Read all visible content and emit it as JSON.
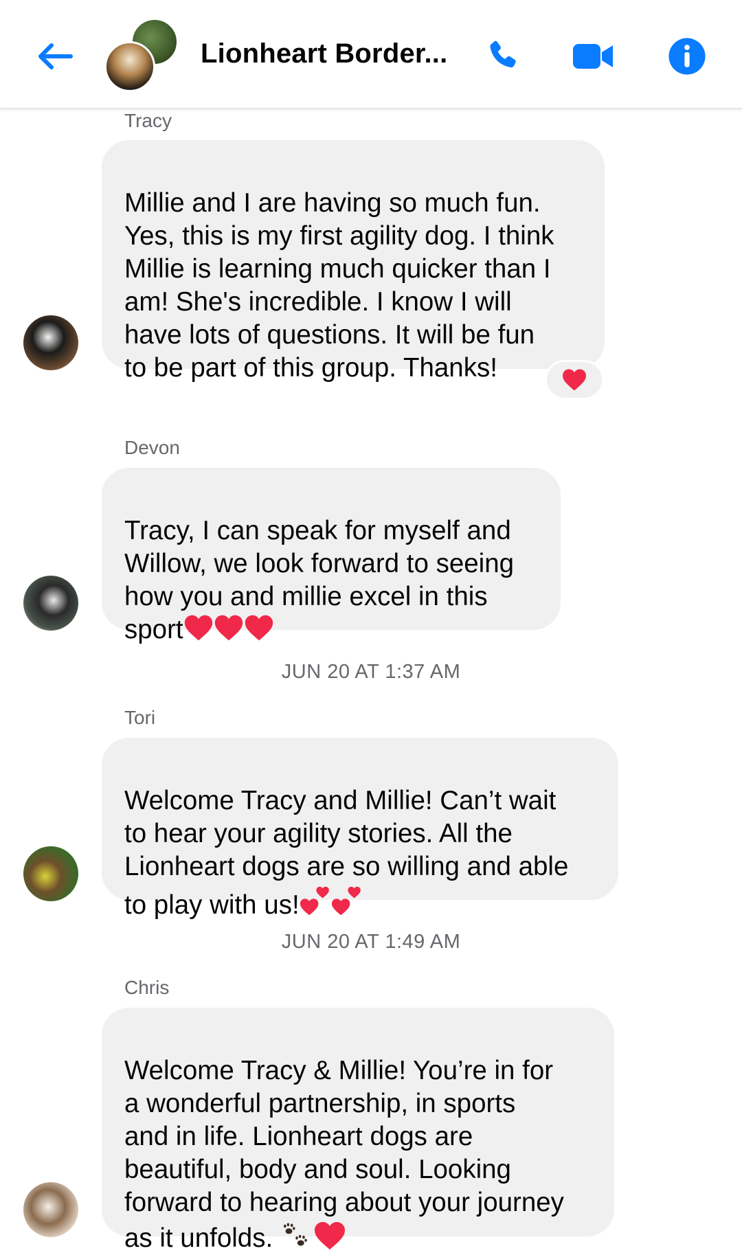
{
  "header": {
    "title": "Lionheart Border...",
    "back_icon": "back-arrow-icon",
    "call_icon": "phone-icon",
    "video_icon": "video-camera-icon",
    "info_icon": "info-icon",
    "accent_color": "#0a7cff"
  },
  "thread": {
    "messages": [
      {
        "sender": "Tracy",
        "text": "Millie and I are having so much fun.\nYes, this is my first agility dog. I think\nMillie is learning much quicker than I\nam! She's incredible.  I know I will\nhave lots of questions.  It will be fun\nto be part of this group.  Thanks!",
        "reaction": "heart-reaction-icon"
      },
      {
        "sender": "Devon",
        "text": "Tracy, I can speak for myself and\nWillow, we look forward to seeing\nhow you and millie excel in this\nsport",
        "emoji": "three-red-hearts-emoji"
      },
      {
        "timestamp": "JUN 20 AT 1:37 AM",
        "sender": "Tori",
        "text": "Welcome Tracy and Millie! Can’t wait\nto hear your agility stories. All the\nLionheart dogs are so willing and able\nto play with us!",
        "emoji": "two-hearts-emoji"
      },
      {
        "timestamp": "JUN 20 AT 1:49 AM",
        "sender": "Chris",
        "text": "Welcome Tracy & Millie! You’re in for\na wonderful partnership, in sports\nand in life. Lionheart dogs are\nbeautiful, body and soul. Looking\nforward to hearing about your journey\nas it unfolds. ",
        "emoji": "paw-prints-heart-emoji"
      }
    ]
  },
  "colors": {
    "bubble": "#f0f0f0",
    "meta_text": "#65676b",
    "heart": "#f02849"
  }
}
